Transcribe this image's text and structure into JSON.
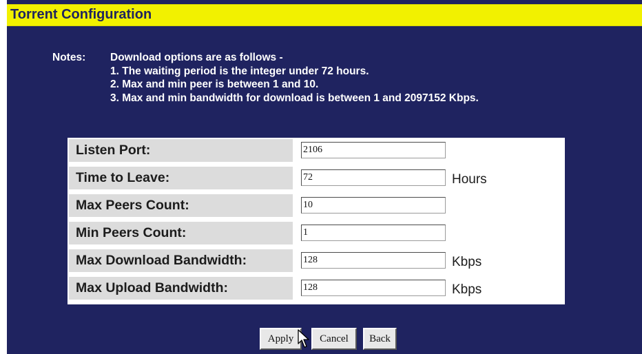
{
  "header": {
    "title": "Torrent Configuration"
  },
  "notes": {
    "label": "Notes:",
    "lines": [
      "Download options are as follows -",
      "1. The waiting period is the integer under 72 hours.",
      "2. Max and min peer is between 1 and 10.",
      "3. Max and min bandwidth for download is between 1 and 2097152 Kbps."
    ]
  },
  "form": {
    "rows": [
      {
        "label": "Listen Port:",
        "value": "2106",
        "unit": ""
      },
      {
        "label": "Time to Leave:",
        "value": "72",
        "unit": "Hours"
      },
      {
        "label": "Max Peers Count:",
        "value": "10",
        "unit": ""
      },
      {
        "label": "Min Peers Count:",
        "value": "1",
        "unit": ""
      },
      {
        "label": "Max Download Bandwidth:",
        "value": "128",
        "unit": "Kbps"
      },
      {
        "label": "Max Upload Bandwidth:",
        "value": "128",
        "unit": "Kbps"
      }
    ]
  },
  "buttons": {
    "apply": "Apply",
    "cancel": "Cancel",
    "back": "Back"
  },
  "colors": {
    "background": "#1f2360",
    "title_bar": "#f2f100",
    "label_cell": "#dcdcdc"
  }
}
